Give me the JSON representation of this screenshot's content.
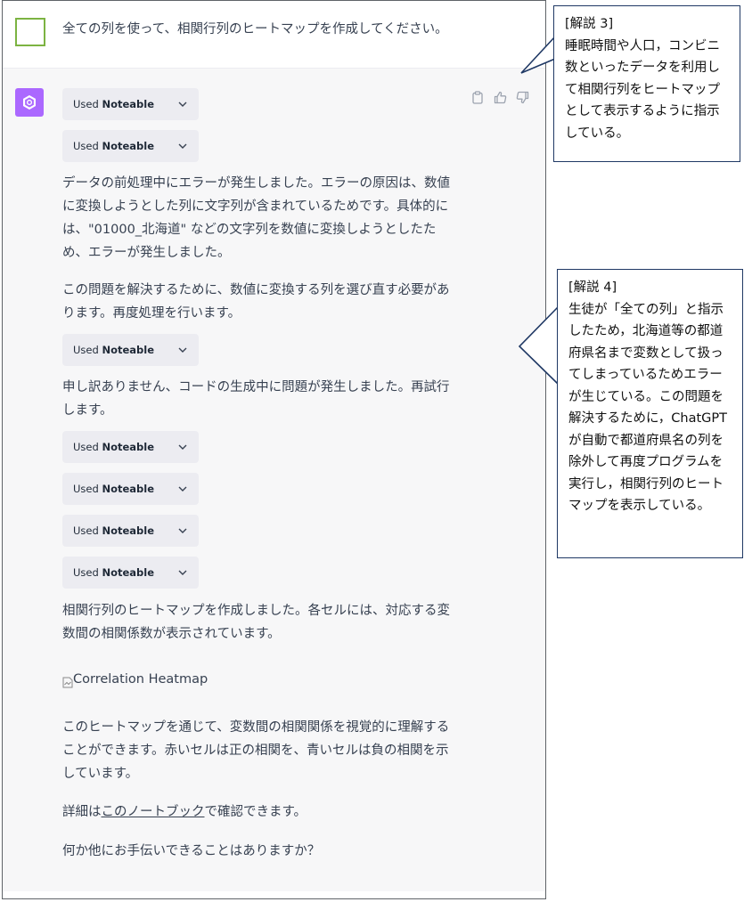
{
  "user": {
    "message": "全ての列を使って、相関行列のヒートマップを作成してください。"
  },
  "assistant": {
    "tool_prefix": "Used",
    "tool_name": "Noteable",
    "paragraphs": {
      "p1": "データの前処理中にエラーが発生しました。エラーの原因は、数値に変換しようとした列に文字列が含まれているためです。具体的には、\"01000_北海道\" などの文字列を数値に変換しようとしたため、エラーが発生しました。",
      "p2": "この問題を解決するために、数値に変換する列を選び直す必要があります。再度処理を行います。",
      "p3": "申し訳ありません、コードの生成中に問題が発生しました。再試行します。",
      "p4": "相関行列のヒートマップを作成しました。各セルには、対応する変数間の相関係数が表示されています。",
      "image_alt": "Correlation Heatmap",
      "p5": "このヒートマップを通じて、変数間の相関関係を視覚的に理解することができます。赤いセルは正の相関を、青いセルは負の相関を示しています。",
      "p6_prefix": "詳細は",
      "p6_link": "このノートブック",
      "p6_suffix": "で確認できます。",
      "p7": "何か他にお手伝いできることはありますか？"
    }
  },
  "callouts": {
    "c3": {
      "title": "[解説 3]",
      "body": "睡眠時間や人口，コンビニ数といったデータを利用して相関行列をヒートマップとして表示するように指示している。"
    },
    "c4": {
      "title": "[解説 4]",
      "body": "生徒が「全ての列」と指示したため，北海道等の都道府県名まで変数として扱ってしまっているためエラーが生じている。この問題を解決するために，ChatGPT が自動で都道府県名の列を除外して再度プログラムを実行し，相関行列のヒートマップを表示している。"
    }
  },
  "icons": {
    "user_avatar": "user-avatar-square",
    "assistant_avatar": "openai-logo-icon",
    "copy": "clipboard-icon",
    "thumbs_up": "thumbs-up-icon",
    "thumbs_down": "thumbs-down-icon",
    "chevron": "chevron-down-icon",
    "broken_image": "broken-image-icon"
  },
  "colors": {
    "assistant_avatar_bg": "#ab68ff",
    "user_avatar_border": "#7cb342",
    "assistant_bg": "#f7f7f8",
    "chip_bg": "#ececf1",
    "callout_border": "#1f3864"
  }
}
